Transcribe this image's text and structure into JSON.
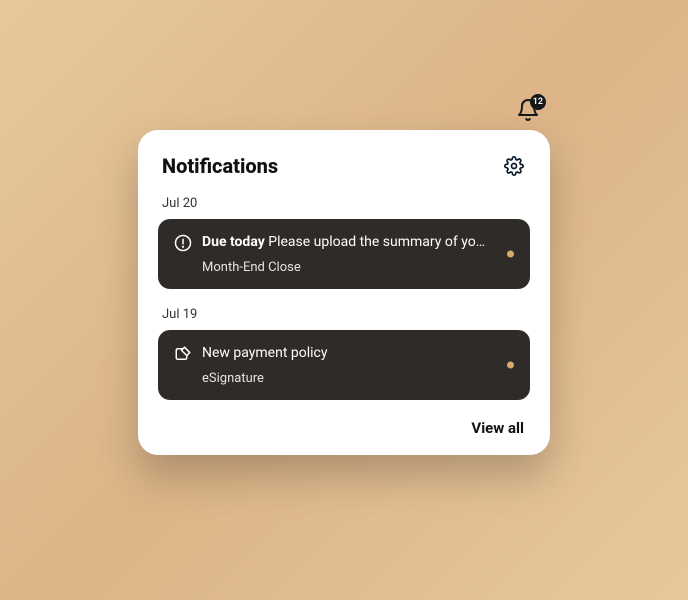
{
  "bell": {
    "count": "12"
  },
  "panel": {
    "title": "Notifications",
    "viewAll": "View all"
  },
  "groups": [
    {
      "date": "Jul 20",
      "item": {
        "prefix": "Due today",
        "text": "Please upload the summary of your...",
        "sub": "Month-End Close",
        "icon": "alert"
      }
    },
    {
      "date": "Jul 19",
      "item": {
        "prefix": "",
        "text": "New payment policy",
        "sub": "eSignature",
        "icon": "signature"
      }
    }
  ]
}
